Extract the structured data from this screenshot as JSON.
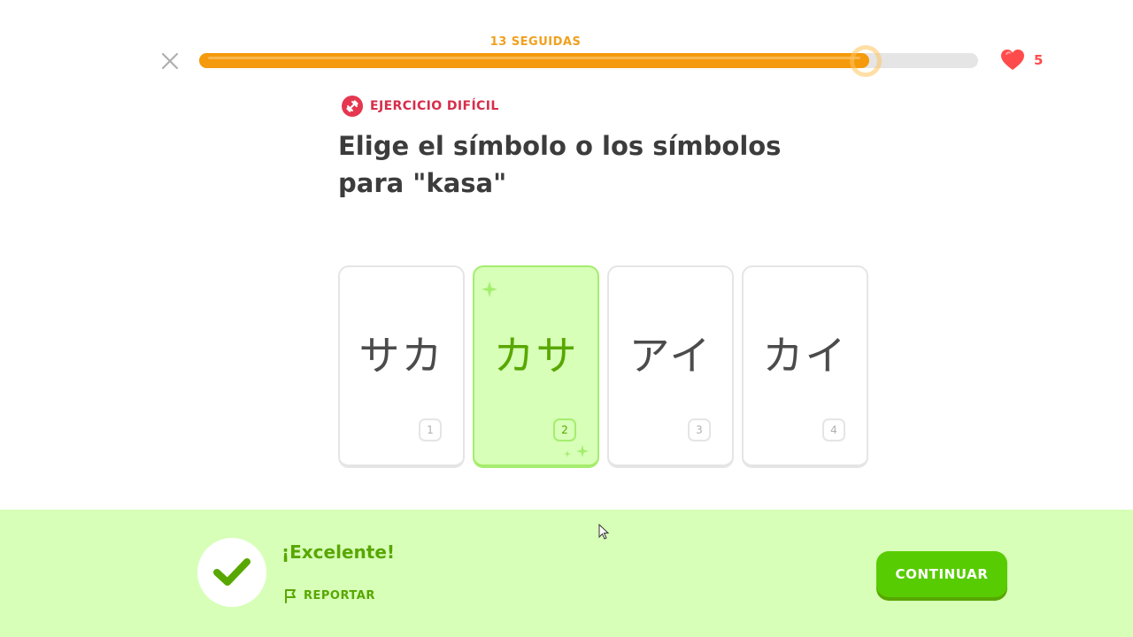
{
  "header": {
    "streak_label": "13 SEGUIDAS",
    "progress_fraction": 0.86,
    "hearts_count": "5"
  },
  "exercise": {
    "badge_label": "EJERCICIO DIFÍCIL",
    "prompt": "Elige el símbolo o los símbolos para \"kasa\"",
    "selected_index": 1,
    "options": [
      {
        "symbols": "サカ",
        "number": "1"
      },
      {
        "symbols": "カサ",
        "number": "2"
      },
      {
        "symbols": "アイ",
        "number": "3"
      },
      {
        "symbols": "カイ",
        "number": "4"
      }
    ]
  },
  "feedback": {
    "title": "¡Excelente!",
    "report_label": "REPORTAR",
    "continue_label": "CONTINUAR"
  },
  "colors": {
    "progress": "#f59a0c",
    "streak_text": "#f0a01e",
    "heart": "#ff4b4b",
    "badge": "#e5374f",
    "correct_green": "#58cc02",
    "correct_text": "#58a700",
    "correct_bg": "#d7ffb8"
  },
  "icons": {
    "close": "close-icon",
    "heart": "heart-icon",
    "badge": "dumbbell-icon",
    "check": "checkmark-icon",
    "report": "flag-icon"
  }
}
